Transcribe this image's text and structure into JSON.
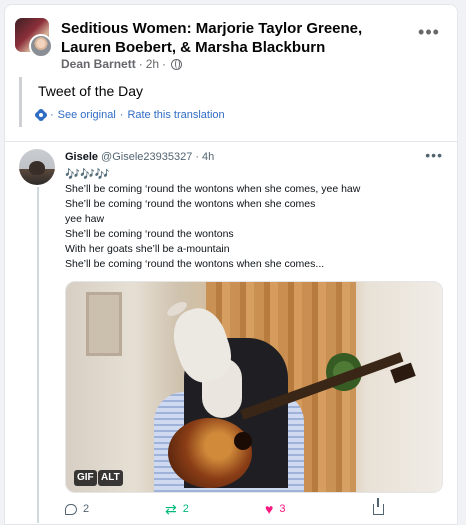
{
  "post": {
    "group_title": "Seditious Women: Marjorie Taylor Greene, Lauren Boebert, & Marsha Blackburn",
    "author": "Dean Barnett",
    "time": "2h",
    "separator": "·",
    "more": "•••",
    "text": "Tweet of the Day",
    "see_original": "See original",
    "rate_translation": "Rate this translation"
  },
  "tweet": {
    "display_name": "Gisele",
    "handle": "@Gisele23935327",
    "time": "4h",
    "more": "•••",
    "lines": [
      "🎶🎶🎶",
      "She’ll be coming ‘round the wontons when she comes, yee haw",
      "She’ll be coming ‘round the wontons when she comes",
      "yee haw",
      "She’ll be coming ‘round the wontons",
      "With her goats she’ll be a-mountain",
      "She’ll be coming ‘round the wontons when she comes..."
    ],
    "media": {
      "badge_gif": "GIF",
      "badge_alt": "ALT"
    },
    "actions": {
      "replies": "2",
      "retweets": "2",
      "likes": "3",
      "retweet_icon": "⇄",
      "like_icon": "♥"
    }
  }
}
